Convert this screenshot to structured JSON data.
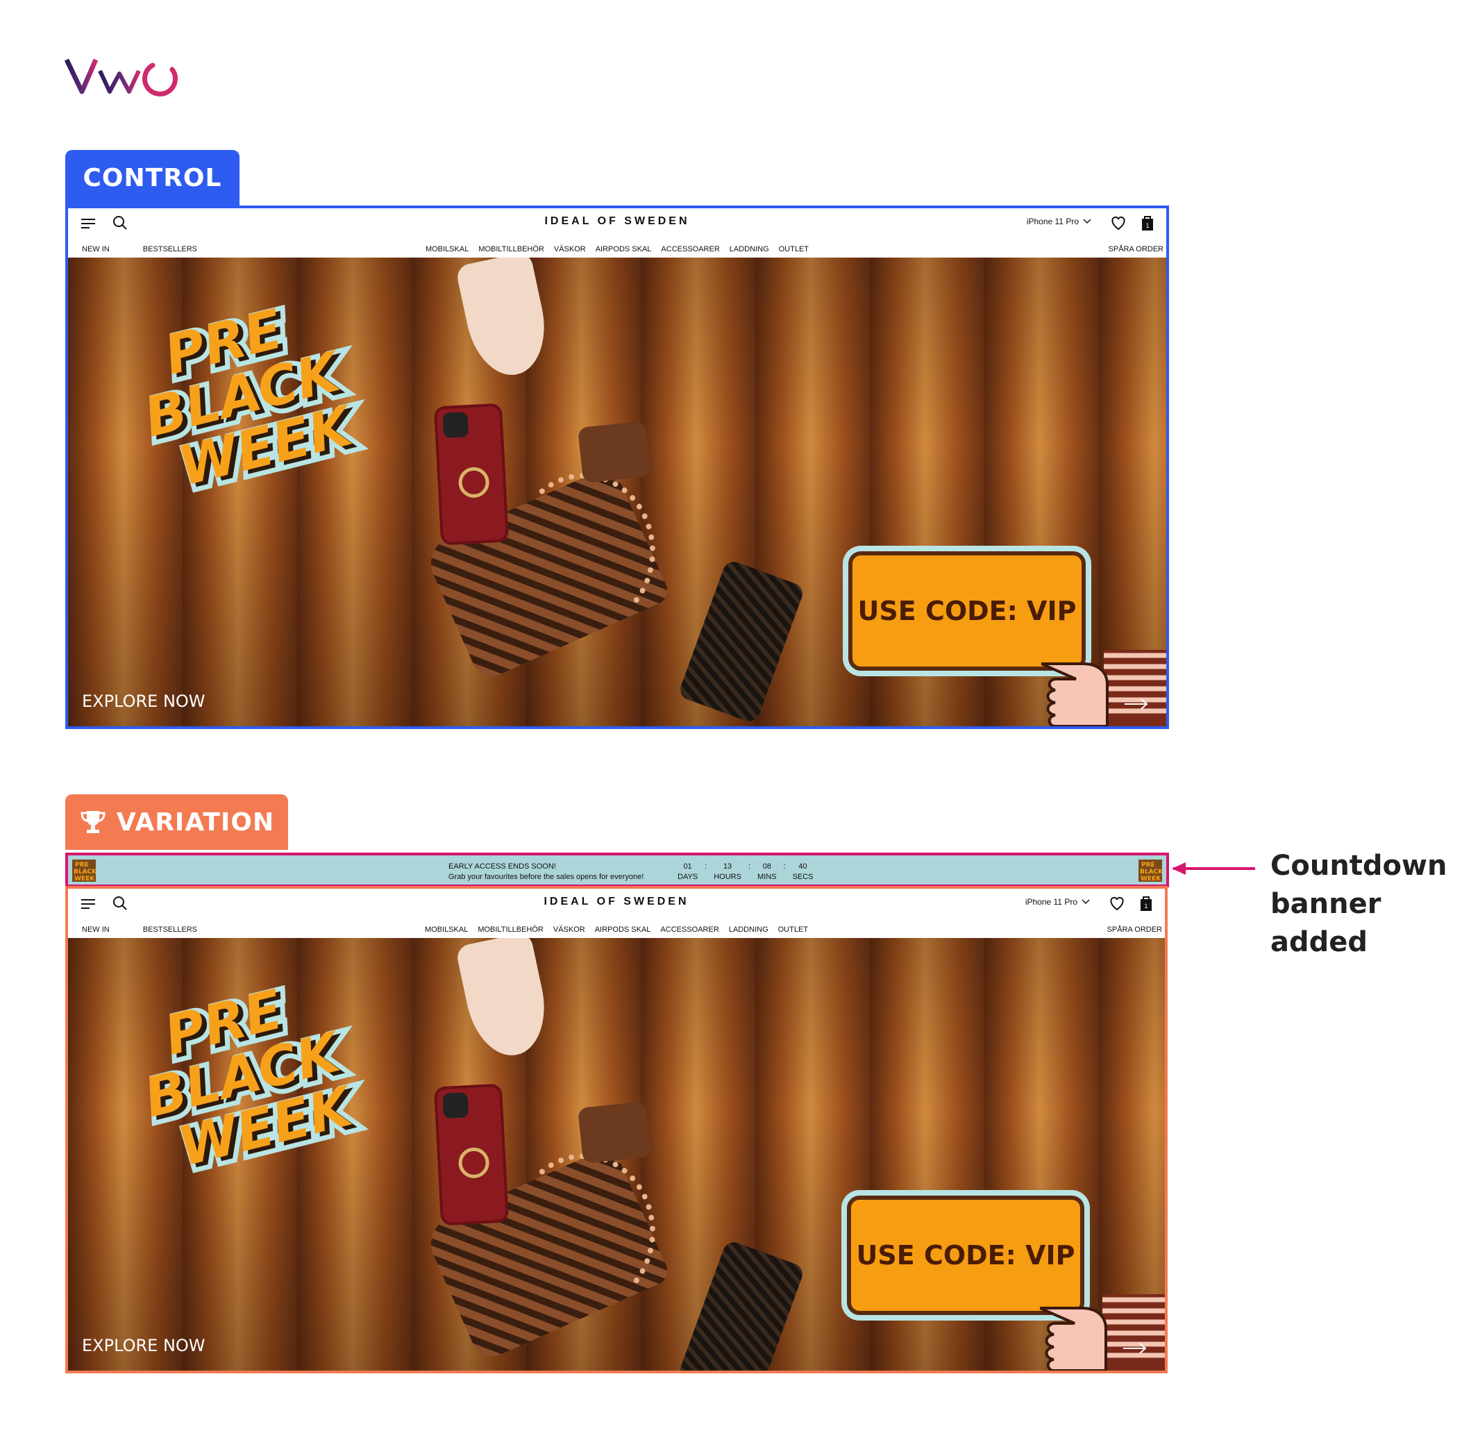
{
  "logo_text": "VWO",
  "colors": {
    "control": "#2e5bf0",
    "variation": "#f47a52",
    "highlight": "#d8156e",
    "banner_bg": "#abd5d9"
  },
  "control": {
    "label": "CONTROL"
  },
  "variation": {
    "label": "VARIATION",
    "label_icon": "trophy-icon"
  },
  "site": {
    "brand": "IDEAL OF SWEDEN",
    "model_select": "iPhone 11 Pro",
    "cart_count": "1",
    "nav_left": [
      "NEW IN",
      "BESTSELLERS"
    ],
    "nav_center": [
      "MOBILSKAL",
      "MOBILTILLBEHÖR",
      "VÄSKOR",
      "AIRPODS SKAL",
      "ACCESSOARER",
      "LADDNING",
      "OUTLET"
    ],
    "nav_right": "SPÅRA ORDER",
    "hero": {
      "headline_lines": [
        "PRE",
        "BLACK",
        "WEEK"
      ],
      "promo": "USE CODE: VIP",
      "cta": "EXPLORE NOW"
    }
  },
  "countdown_banner": {
    "title": "EARLY ACCESS ENDS SOON!",
    "subtitle": "Grab your favourites before the sales opens for everyone!",
    "timer": [
      {
        "value": "01",
        "unit": "DAYS"
      },
      {
        "value": "13",
        "unit": "HOURS"
      },
      {
        "value": "08",
        "unit": "MINS"
      },
      {
        "value": "40",
        "unit": "SECS"
      }
    ]
  },
  "annotation": {
    "lines": [
      "Countdown",
      "banner",
      "added"
    ]
  }
}
